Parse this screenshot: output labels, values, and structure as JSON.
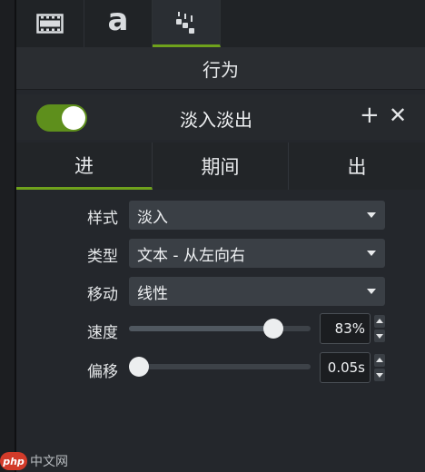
{
  "top_tabs": [
    {
      "icon": "film-strip-icon",
      "active": false
    },
    {
      "icon": "text-a-icon",
      "glyph": "a",
      "active": false
    },
    {
      "icon": "behaviors-icon",
      "active": true
    }
  ],
  "panel_title": "行为",
  "effect": {
    "name": "淡入淡出",
    "enabled": true
  },
  "phase_tabs": [
    {
      "label": "进",
      "active": true
    },
    {
      "label": "期间",
      "active": false
    },
    {
      "label": "出",
      "active": false
    }
  ],
  "properties": {
    "style": {
      "label": "样式",
      "value": "淡入"
    },
    "type": {
      "label": "类型",
      "value": "文本 - 从左向右"
    },
    "movement": {
      "label": "移动",
      "value": "线性"
    },
    "speed": {
      "label": "速度",
      "value": "83%",
      "level": 0.83
    },
    "offset": {
      "label": "偏移",
      "value": "0.05s",
      "level": 0.0
    }
  },
  "watermark": {
    "logo": "php",
    "text": "中文网"
  },
  "colors": {
    "accent": "#6fa21c",
    "toggle_on": "#5e8f1c",
    "panel_bg": "#24272c"
  }
}
